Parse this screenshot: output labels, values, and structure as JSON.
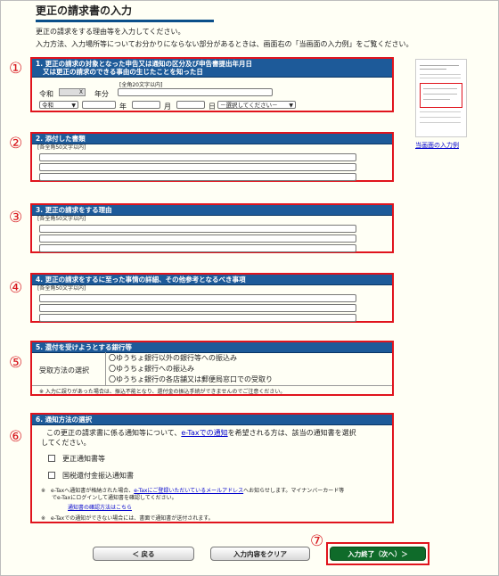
{
  "page": {
    "title": "更正の請求書の入力",
    "intro1": "更正の請求をする理由等を入力してください。",
    "intro2": "入力方法、入力場所等についてお分かりにならない部分があるときは、画面右の「当画面の入力例」をご覧ください。"
  },
  "markers": [
    "①",
    "②",
    "③",
    "④",
    "⑤",
    "⑥",
    "⑦"
  ],
  "sample": {
    "link": "当画面の入力例"
  },
  "s1": {
    "header1": "1. 更正の請求の対象となった申告又は通知の区分及び申告書提出年月日",
    "header2": "又は更正の請求のできる事由の生じたことを知った日",
    "era_label": "令和",
    "era_clear": "X",
    "year_suffix": "年分",
    "hint": "[全角20文字以内]",
    "era_select": "令和",
    "year": "年",
    "month": "月",
    "day": "日",
    "category_select": "－選択してください－"
  },
  "s2": {
    "header": "2. 添付した書類",
    "hint": "[各全角50文字以内]"
  },
  "s3": {
    "header": "3. 更正の請求をする理由",
    "hint": "[各全角50文字以内]"
  },
  "s4": {
    "header": "4. 更正の請求をするに至った事情の詳細、その他参考となるべき事項",
    "hint": "[各全角50文字以内]"
  },
  "s5": {
    "header": "5. 還付を受けようとする銀行等",
    "label": "受取方法の選択",
    "opt1": "〇ゆうちょ銀行以外の銀行等への振込み",
    "opt2": "〇ゆうちょ銀行への振込み",
    "opt3": "〇ゆうちょ銀行の各店舗又は郵便局窓口での受取り",
    "note": "※ 入力に誤りがあった場合は、振込不能となり、還付金の振込手続ができませんのでご注意ください。"
  },
  "s6": {
    "header": "6. 通知方法の選択",
    "text_a": "この更正の請求書に係る通知等について、",
    "text_link": "e-Taxでの通知",
    "text_b": "を希望される方は、該当の通知書を選択",
    "text_c": "してください。",
    "cb1": "更正通知書等",
    "cb2": "国税還付金振込通知書",
    "note1_a": "※　e-Taxへ通知書が格納された場合、",
    "note1_link": "e-Taxにご登録いただいているメールアドレス",
    "note1_b": "へお知らせします。マイナンバーカード等",
    "note1_c": "でe-Taxにログインして通知書を確認してください。",
    "confirm_link": "通知書の確認方法はこちら",
    "note2": "※　e-Taxでの通知ができない場合には、書面で通知書が送付されます。"
  },
  "buttons": {
    "back": "＜ 戻る",
    "clear": "入力内容をクリア",
    "next": "入力終了（次へ）＞"
  }
}
